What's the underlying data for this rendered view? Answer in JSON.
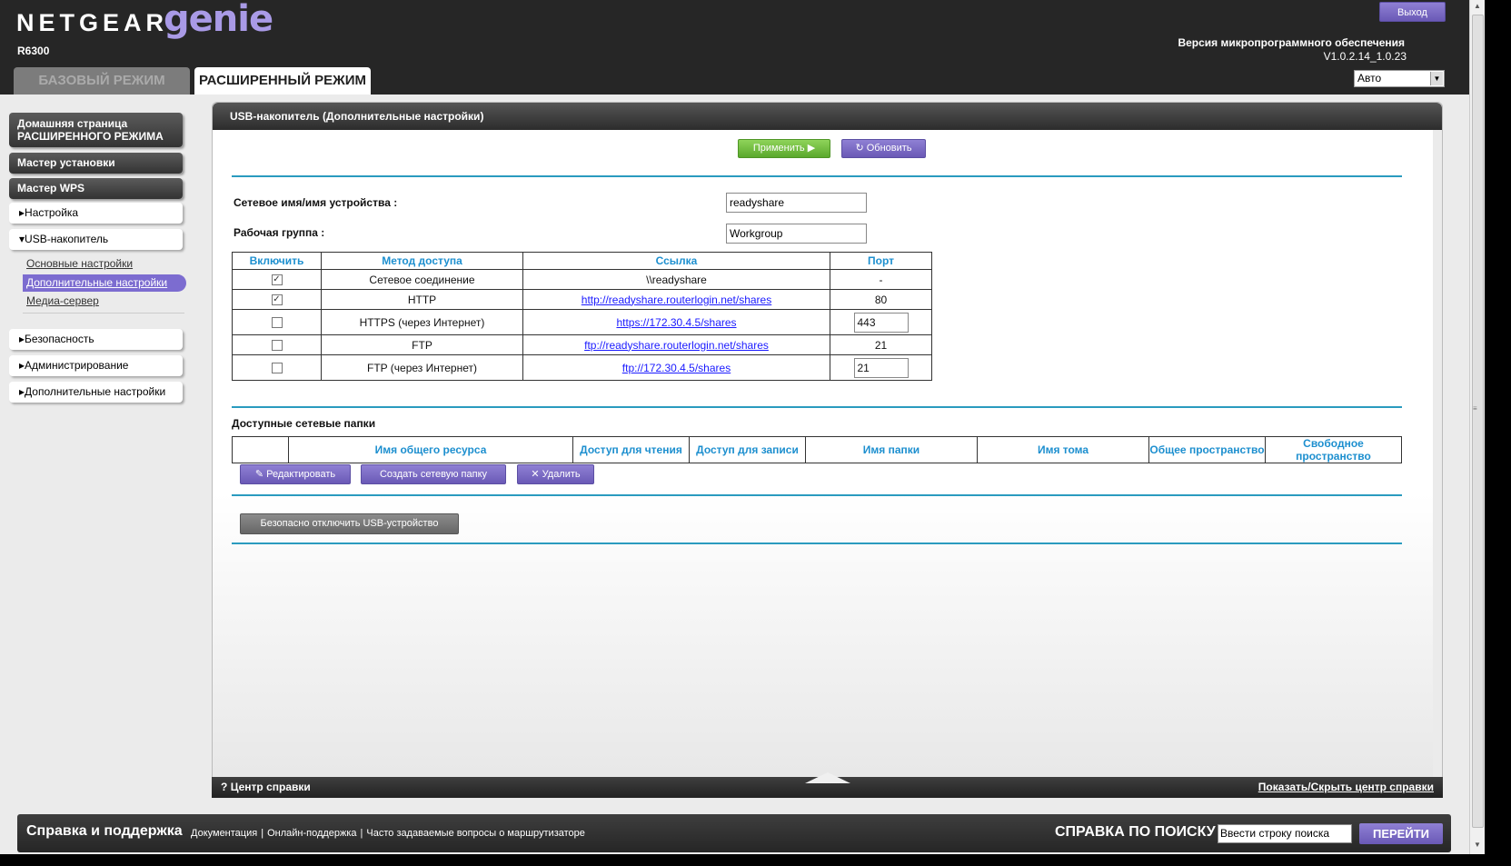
{
  "header": {
    "logo_word": "NETGEAR",
    "logo_genie": "genie",
    "logo_tm": "™",
    "model": "R6300",
    "tab_basic": "БАЗОВЫЙ РЕЖИМ",
    "tab_advanced": "РАСШИРЕННЫЙ РЕЖИМ",
    "logout": "Выход",
    "firmware_label": "Версия микропрограммного обеспечения",
    "firmware_version": "V1.0.2.14_1.0.23",
    "language": "Авто"
  },
  "sidebar": {
    "home": "Домашняя страница РАСШИРЕННОГО РЕЖИМА",
    "setup_wizard": "Мастер установки",
    "wps_wizard": "Мастер WPS",
    "setup": "Настройка",
    "usb": "USB-накопитель",
    "usb_basic": "Основные настройки",
    "usb_advanced": "Дополнительные настройки",
    "media_server": "Медиа-сервер",
    "security": "Безопасность",
    "admin": "Администрирование",
    "advanced_setup": "Дополнительные настройки"
  },
  "panel": {
    "title": "USB-накопитель (Дополнительные настройки)",
    "apply": "Применить",
    "refresh": "Обновить",
    "device_name_label": "Сетевое имя/имя устройства :",
    "device_name_value": "readyshare",
    "workgroup_label": "Рабочая группа :",
    "workgroup_value": "Workgroup",
    "access_headers": [
      "Включить",
      "Метод доступа",
      "Ссылка",
      "Порт"
    ],
    "access_rows": [
      {
        "enabled": true,
        "method": "Сетевое соединение",
        "link": "\\\\readyshare",
        "link_is_url": false,
        "port": "-",
        "port_editable": false
      },
      {
        "enabled": true,
        "method": "HTTP",
        "link": "http://readyshare.routerlogin.net/shares",
        "link_is_url": true,
        "port": "80",
        "port_editable": false
      },
      {
        "enabled": false,
        "method": "HTTPS (через Интернет)",
        "link": "https://172.30.4.5/shares",
        "link_is_url": true,
        "port": "443",
        "port_editable": true
      },
      {
        "enabled": false,
        "method": "FTP",
        "link": "ftp://readyshare.routerlogin.net/shares",
        "link_is_url": true,
        "port": "21",
        "port_editable": false
      },
      {
        "enabled": false,
        "method": "FTP (через Интернет)",
        "link": "ftp://172.30.4.5/shares",
        "link_is_url": true,
        "port": "21",
        "port_editable": true
      }
    ],
    "folders_title": "Доступные сетевые папки",
    "folder_headers": [
      "",
      "Имя общего ресурса",
      "Доступ для чтения",
      "Доступ для записи",
      "Имя папки",
      "Имя тома",
      "Общее пространство",
      "Свободное пространство"
    ],
    "edit": "Редактировать",
    "create_folder": "Создать сетевую папку",
    "delete": "Удалить",
    "safe_remove": "Безопасно отключить USB-устройство",
    "help_center": "Центр справки",
    "help_toggle": "Показать/Скрыть центр справки"
  },
  "footer": {
    "title": "Справка и поддержка",
    "links": [
      "Документация",
      "Онлайн-поддержка",
      "Часто задаваемые вопросы о маршрутизаторе"
    ],
    "search_label": "СПРАВКА ПО ПОИСКУ",
    "search_placeholder": "Ввести строку поиска",
    "go": "ПЕРЕЙТИ"
  },
  "colors": {
    "accent_purple": "#7c6cd0",
    "apply_green": "#6cbf3c",
    "header_link_blue": "#1d8fcf",
    "divider_blue": "#2a9bbf"
  }
}
